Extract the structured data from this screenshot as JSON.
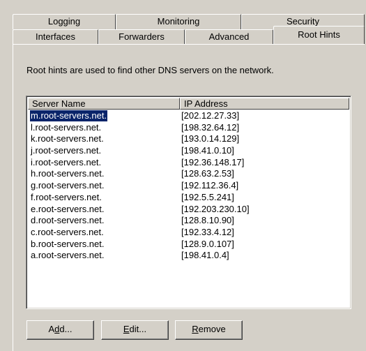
{
  "tabs_back": [
    "Logging",
    "Monitoring",
    "Security"
  ],
  "tabs_front": [
    "Interfaces",
    "Forwarders",
    "Advanced",
    "Root Hints"
  ],
  "active_tab": "Root Hints",
  "description": "Root hints are used to find other DNS servers on the network.",
  "columns": [
    "Server Name",
    "IP Address"
  ],
  "rows": [
    {
      "name": "m.root-servers.net.",
      "ip": "[202.12.27.33]",
      "selected": true
    },
    {
      "name": "l.root-servers.net.",
      "ip": "[198.32.64.12]"
    },
    {
      "name": "k.root-servers.net.",
      "ip": "[193.0.14.129]"
    },
    {
      "name": "j.root-servers.net.",
      "ip": "[198.41.0.10]"
    },
    {
      "name": "i.root-servers.net.",
      "ip": "[192.36.148.17]"
    },
    {
      "name": "h.root-servers.net.",
      "ip": "[128.63.2.53]"
    },
    {
      "name": "g.root-servers.net.",
      "ip": "[192.112.36.4]"
    },
    {
      "name": "f.root-servers.net.",
      "ip": "[192.5.5.241]"
    },
    {
      "name": "e.root-servers.net.",
      "ip": "[192.203.230.10]"
    },
    {
      "name": "d.root-servers.net.",
      "ip": "[128.8.10.90]"
    },
    {
      "name": "c.root-servers.net.",
      "ip": "[192.33.4.12]"
    },
    {
      "name": "b.root-servers.net.",
      "ip": "[128.9.0.107]"
    },
    {
      "name": "a.root-servers.net.",
      "ip": "[198.41.0.4]"
    }
  ],
  "buttons": {
    "add": {
      "prefix": "A",
      "key": "d",
      "suffix": "d..."
    },
    "edit": {
      "prefix": "",
      "key": "E",
      "suffix": "dit..."
    },
    "remove": {
      "prefix": "",
      "key": "R",
      "suffix": "emove"
    }
  }
}
